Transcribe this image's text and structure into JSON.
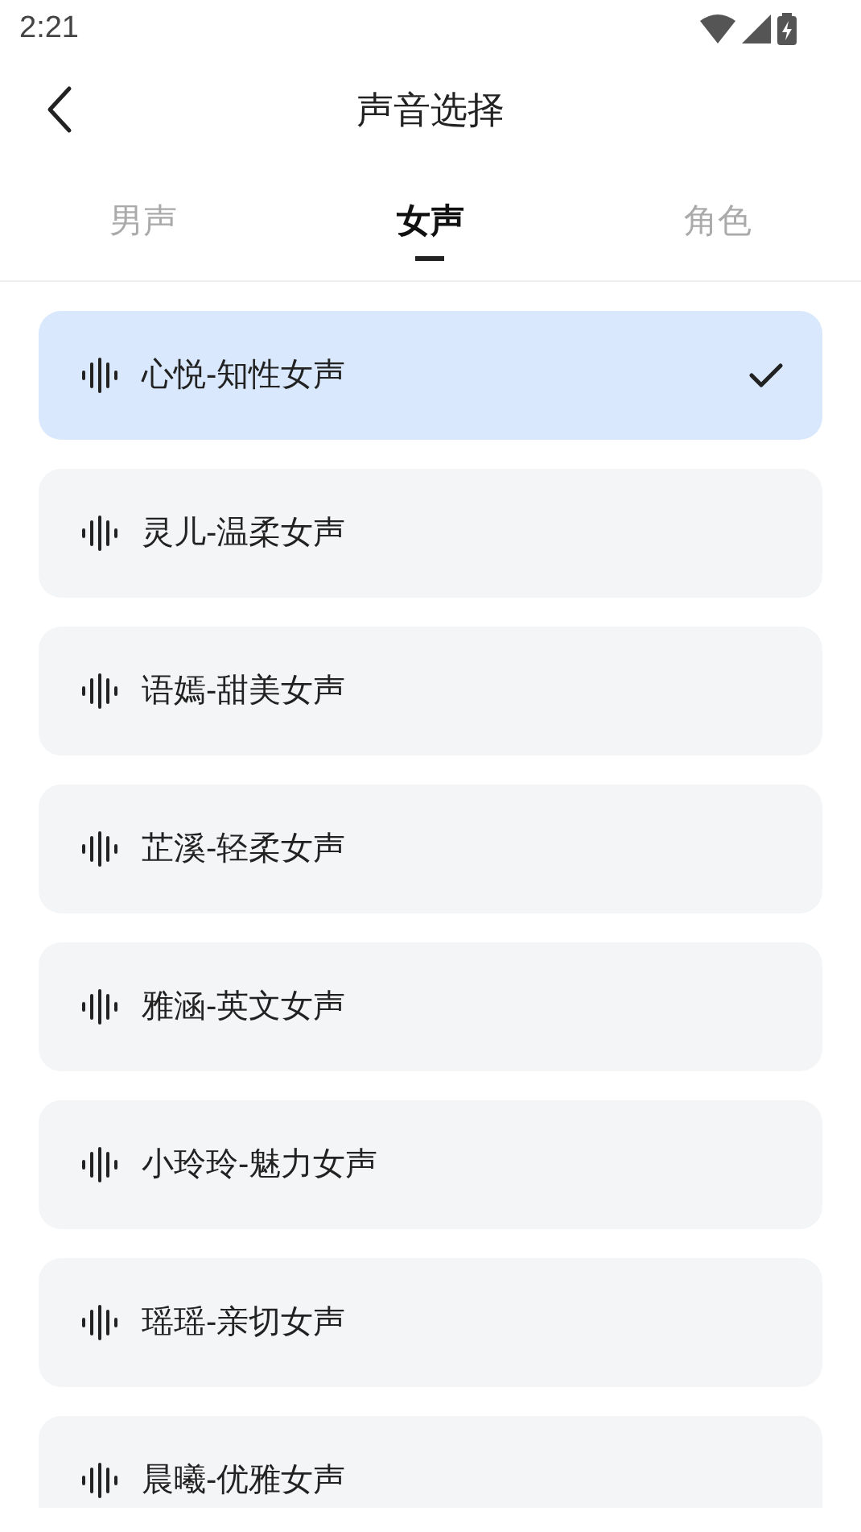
{
  "status_bar": {
    "time": "2:21"
  },
  "header": {
    "title": "声音选择"
  },
  "tabs": [
    {
      "label": "男声",
      "selected": false
    },
    {
      "label": "女声",
      "selected": true
    },
    {
      "label": "角色",
      "selected": false
    }
  ],
  "voices": [
    {
      "name": "心悦-知性女声",
      "selected": true
    },
    {
      "name": "灵儿-温柔女声",
      "selected": false
    },
    {
      "name": "语嫣-甜美女声",
      "selected": false
    },
    {
      "name": "芷溪-轻柔女声",
      "selected": false
    },
    {
      "name": "雅涵-英文女声",
      "selected": false
    },
    {
      "name": "小玲玲-魅力女声",
      "selected": false
    },
    {
      "name": "瑶瑶-亲切女声",
      "selected": false
    },
    {
      "name": "晨曦-优雅女声",
      "selected": false
    }
  ]
}
